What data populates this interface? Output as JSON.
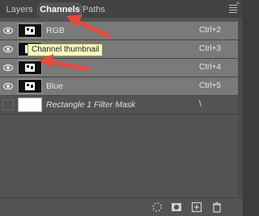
{
  "tabs": [
    {
      "label": "Layers"
    },
    {
      "label": "Channels"
    },
    {
      "label": "Paths"
    }
  ],
  "channels": [
    {
      "name": "RGB",
      "shortcut": "Ctrl+2",
      "visible": true,
      "selected": true,
      "thumb": "dark"
    },
    {
      "name": "",
      "shortcut": "Ctrl+3",
      "visible": true,
      "selected": true,
      "thumb": "dark"
    },
    {
      "name": "",
      "shortcut": "Ctrl+4",
      "visible": true,
      "selected": true,
      "thumb": "dark"
    },
    {
      "name": "Blue",
      "shortcut": "Ctrl+5",
      "visible": true,
      "selected": true,
      "thumb": "dark"
    },
    {
      "name": "Rectangle 1 Filter Mask",
      "shortcut": "\\",
      "visible": false,
      "selected": false,
      "thumb": "white"
    }
  ],
  "tooltip": "Channel thumbnail",
  "annotation_color": "#e8493c",
  "bottom_icons": [
    "load-selection-icon",
    "save-selection-icon",
    "new-channel-icon",
    "delete-icon"
  ]
}
